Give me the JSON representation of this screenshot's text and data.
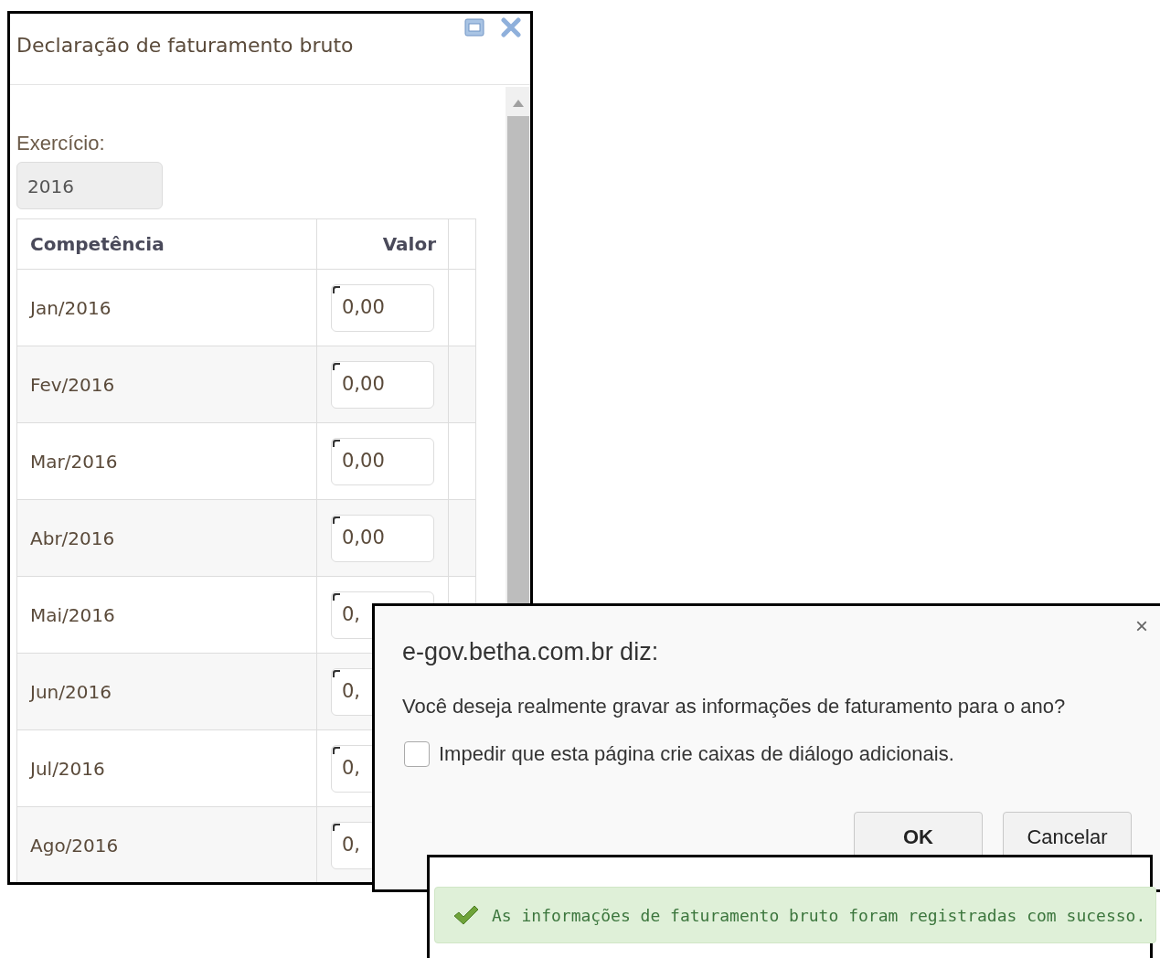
{
  "panel": {
    "title": "Declaração de faturamento bruto",
    "year_label": "Exercício:",
    "year_value": "2016",
    "columns": [
      "Competência",
      "Valor"
    ],
    "rows": [
      {
        "month": "Jan/2016",
        "value": "0,00"
      },
      {
        "month": "Fev/2016",
        "value": "0,00"
      },
      {
        "month": "Mar/2016",
        "value": "0,00"
      },
      {
        "month": "Abr/2016",
        "value": "0,00"
      },
      {
        "month": "Mai/2016",
        "value": "0,"
      },
      {
        "month": "Jun/2016",
        "value": "0,"
      },
      {
        "month": "Jul/2016",
        "value": "0,"
      },
      {
        "month": "Ago/2016",
        "value": "0,"
      }
    ]
  },
  "dialog": {
    "title": "e-gov.betha.com.br diz:",
    "close": "×",
    "message": "Você deseja realmente gravar as informações de faturamento para o ano?",
    "checkbox": {
      "label": "Impedir que esta página crie caixas de diálogo adicionais.",
      "checked": false
    },
    "buttons": [
      {
        "label": "OK",
        "default": true
      },
      {
        "label": "Cancelar",
        "default": false
      }
    ]
  },
  "toast": {
    "message": "As informações de faturamento bruto foram registradas com sucesso."
  }
}
